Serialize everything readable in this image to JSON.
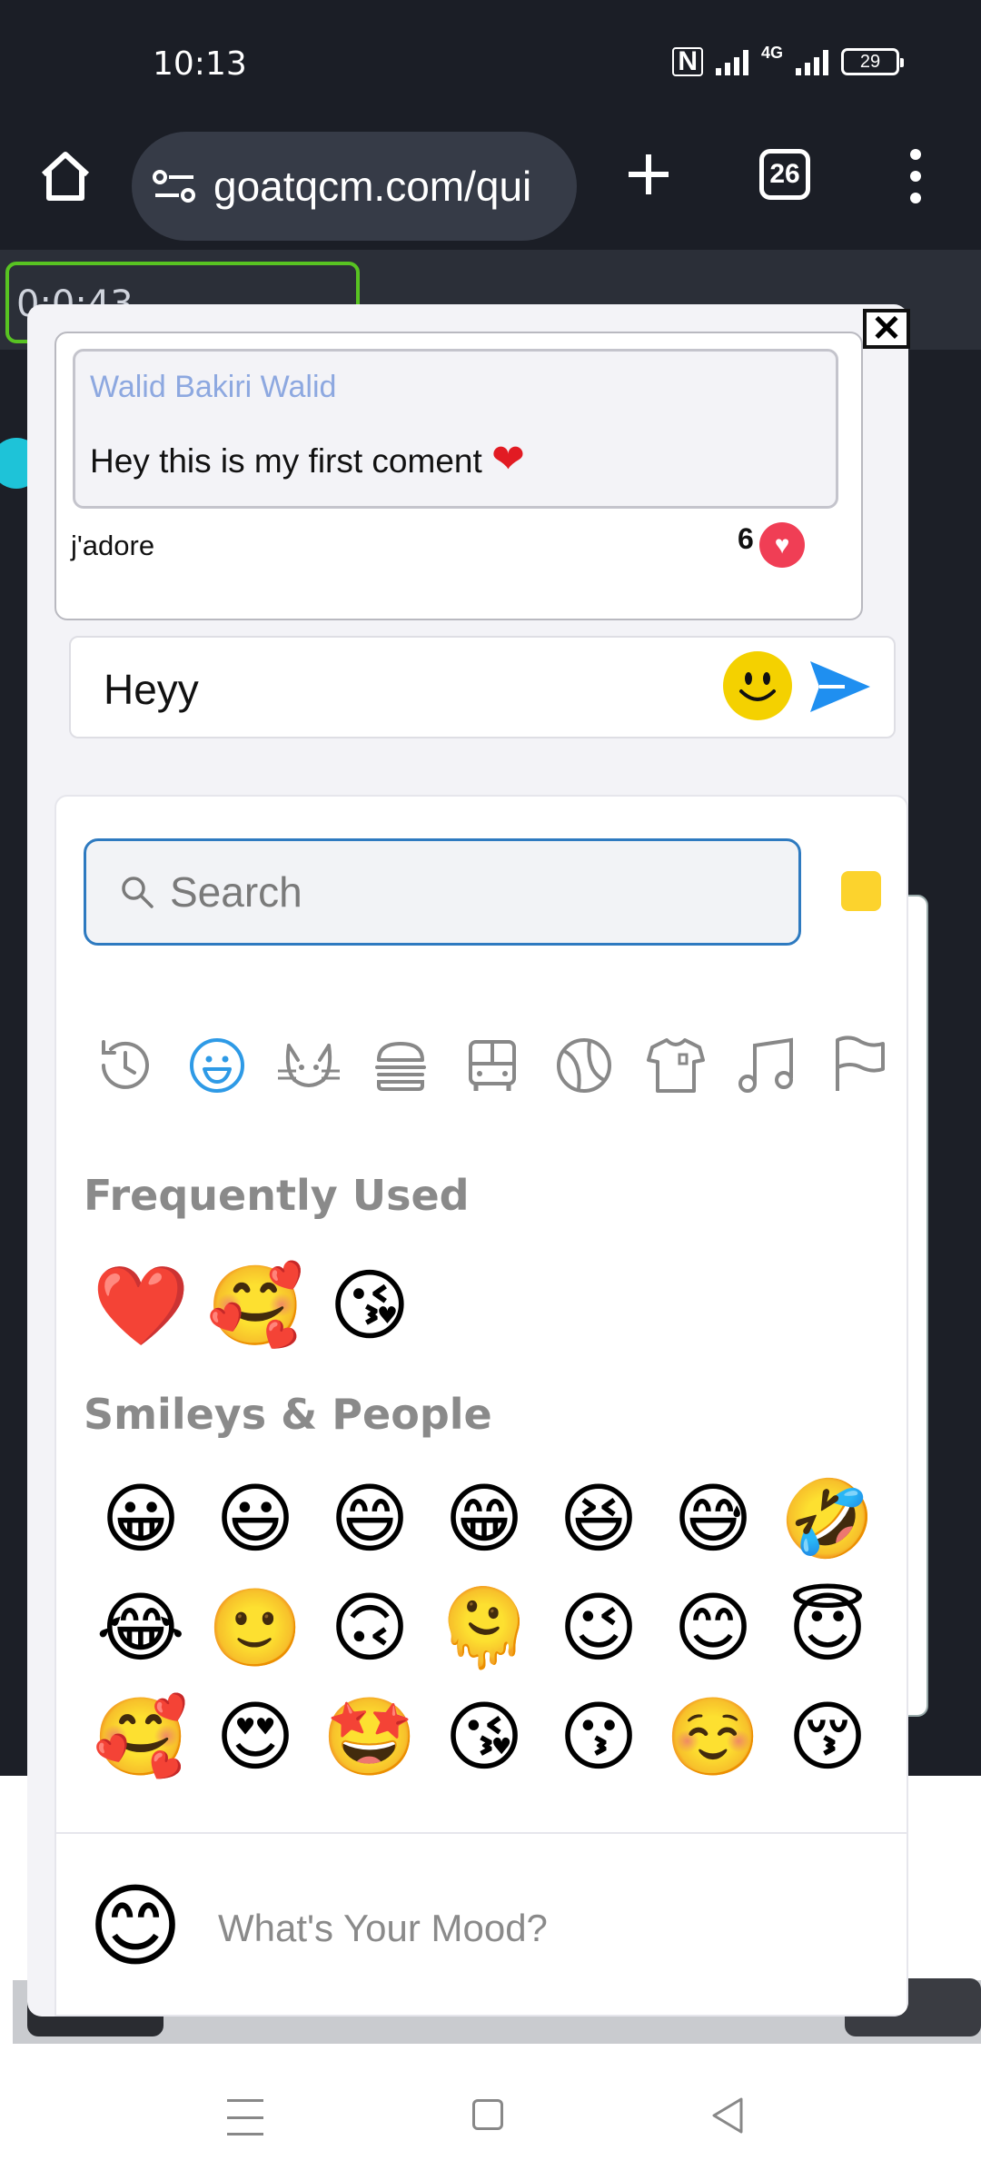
{
  "status_bar": {
    "time": "10:13",
    "network": "4G",
    "battery": "29"
  },
  "browser": {
    "url": "goatqcm.com/qui",
    "tab_count": "26"
  },
  "page": {
    "timer": "0:0:43"
  },
  "modal": {
    "close_label": "✕"
  },
  "comment": {
    "author": "Walid Bakiri Walid",
    "text": "Hey this is my first coment",
    "reaction_label": "j'adore",
    "like_count": "6"
  },
  "composer": {
    "value": "Heyy"
  },
  "emoji_picker": {
    "search_placeholder": "Search",
    "categories": [
      "recent-icon",
      "smileys-icon",
      "animals-icon",
      "food-icon",
      "travel-icon",
      "activities-icon",
      "objects-icon",
      "symbols-icon",
      "flags-icon"
    ],
    "frequently_used_title": "Frequently Used",
    "frequently_used": [
      "❤️",
      "🥰",
      "😘"
    ],
    "smileys_title": "Smileys & People",
    "smileys_rows": [
      [
        "😀",
        "😃",
        "😄",
        "😁",
        "😆",
        "😅",
        "🤣"
      ],
      [
        "😂",
        "🙂",
        "🙃",
        "🫠",
        "😉",
        "😊",
        "😇"
      ],
      [
        "🥰",
        "😍",
        "🤩",
        "😘",
        "😗",
        "☺️",
        "😚"
      ]
    ],
    "footer_emoji": "😊",
    "footer_text": "What's Your Mood?"
  },
  "colors": {
    "accent": "#2e7ac0",
    "send": "#1f8ff0",
    "heart": "#e21b23",
    "timer_border": "#58c322"
  }
}
